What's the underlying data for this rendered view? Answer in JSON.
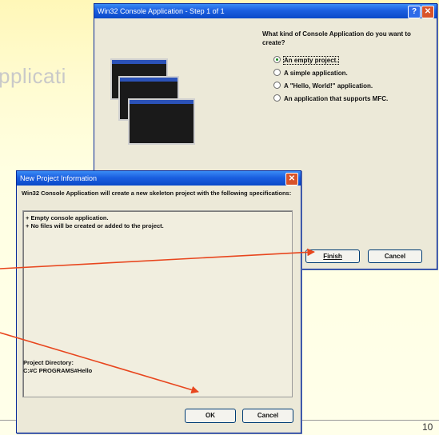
{
  "slide": {
    "title_fragment": "pplicati",
    "page_number": "10"
  },
  "dialog1": {
    "title": "Win32 Console Application - Step 1 of 1",
    "help_glyph": "?",
    "close_glyph": "✕",
    "question": "What kind of Console Application do you want to create?",
    "options": [
      {
        "label": "An empty project.",
        "selected": true
      },
      {
        "label": "A simple application.",
        "selected": false
      },
      {
        "label": "A \"Hello, World!\" application.",
        "selected": false
      },
      {
        "label": "An application that supports MFC.",
        "selected": false
      }
    ],
    "finish_label": "Finish",
    "cancel_label": "Cancel"
  },
  "dialog2": {
    "title": "New Project Information",
    "close_glyph": "✕",
    "description": "Win32 Console Application will create a new skeleton project with the following specifications:",
    "spec_lines": [
      "+ Empty console application.",
      "+ No files will be created or added to the project."
    ],
    "project_dir_label": "Project Directory:",
    "project_dir_value": "C:#C PROGRAMS#Hello",
    "ok_label": "OK",
    "cancel_label": "Cancel"
  },
  "colors": {
    "arrow": "#e8461e",
    "titlebar": "#1b5fe0",
    "dialog_face": "#ece9d8"
  }
}
